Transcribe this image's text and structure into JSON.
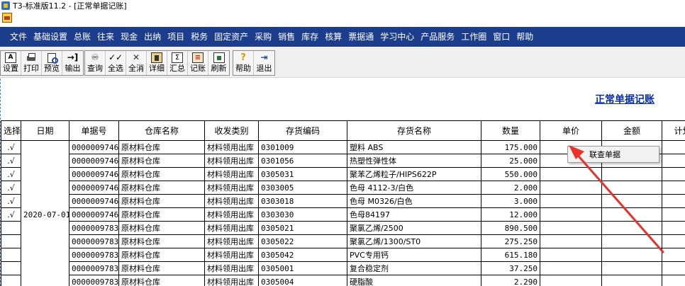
{
  "window": {
    "title": "T3-标准版11.2 - [正常单据记账]"
  },
  "menu": {
    "items": [
      "文件",
      "基础设置",
      "总账",
      "往来",
      "现金",
      "出纳",
      "项目",
      "税务",
      "固定资产",
      "采购",
      "销售",
      "库存",
      "核算",
      "票据通",
      "学习中心",
      "产品服务",
      "工作圈",
      "窗口",
      "帮助"
    ]
  },
  "toolbar": {
    "groups": [
      [
        {
          "label": "设置",
          "icon": "settings-icon"
        },
        {
          "label": "打印",
          "icon": "printer-icon"
        },
        {
          "label": "预览",
          "icon": "preview-icon"
        },
        {
          "label": "输出",
          "icon": "export-icon"
        }
      ],
      [
        {
          "label": "查询",
          "icon": "binoculars-icon"
        },
        {
          "label": "全选",
          "icon": "select-all-icon"
        },
        {
          "label": "全消",
          "icon": "deselect-all-icon"
        },
        {
          "label": "详细",
          "icon": "detail-icon"
        },
        {
          "label": "汇总",
          "icon": "summary-icon"
        },
        {
          "label": "记账",
          "icon": "ledger-icon"
        },
        {
          "label": "刷新",
          "icon": "refresh-icon"
        }
      ],
      [
        {
          "label": "帮助",
          "icon": "help-icon"
        },
        {
          "label": "退出",
          "icon": "exit-icon"
        }
      ]
    ]
  },
  "report": {
    "title": "正常单据记账"
  },
  "table": {
    "columns": [
      "选择",
      "日期",
      "单据号",
      "仓库名称",
      "收发类别",
      "存货编码",
      "存货名称",
      "数量",
      "单价",
      "金额",
      "计划"
    ],
    "date_group": "2020-07-01",
    "select_mark": ".√",
    "rows": [
      {
        "selected": true,
        "doc": "0000009746",
        "warehouse": "原材料仓库",
        "category": "材料领用出库",
        "code": "0301009",
        "name": "塑料 ABS",
        "qty": "175.000"
      },
      {
        "selected": true,
        "doc": "0000009746",
        "warehouse": "原材料仓库",
        "category": "材料领用出库",
        "code": "0301056",
        "name": "热塑性弹性体",
        "qty": "25.000"
      },
      {
        "selected": true,
        "doc": "0000009746",
        "warehouse": "原材料仓库",
        "category": "材料领用出库",
        "code": "0305031",
        "name": "聚苯乙烯粒子/HIPS622P",
        "qty": "550.000"
      },
      {
        "selected": true,
        "doc": "0000009746",
        "warehouse": "原材料仓库",
        "category": "材料领用出库",
        "code": "0303005",
        "name": "色母 4112-3/白色",
        "qty": "2.000"
      },
      {
        "selected": true,
        "doc": "0000009746",
        "warehouse": "原材料仓库",
        "category": "材料领用出库",
        "code": "0303018",
        "name": "色母 M0326/白色",
        "qty": "3.000"
      },
      {
        "selected": true,
        "doc": "0000009746",
        "warehouse": "原材料仓库",
        "category": "材料领用出库",
        "code": "0303030",
        "name": "色母84197",
        "qty": "12.000"
      },
      {
        "selected": false,
        "doc": "0000009783",
        "warehouse": "原材料仓库",
        "category": "材料领用出库",
        "code": "0305021",
        "name": "聚氯乙烯/2500",
        "qty": "890.500"
      },
      {
        "selected": false,
        "doc": "0000009783",
        "warehouse": "原材料仓库",
        "category": "材料领用出库",
        "code": "0305022",
        "name": "聚氯乙烯/1300/ST0",
        "qty": "275.250"
      },
      {
        "selected": false,
        "doc": "0000009783",
        "warehouse": "原材料仓库",
        "category": "材料领用出库",
        "code": "0305042",
        "name": "PVC专用钙",
        "qty": "615.180"
      },
      {
        "selected": false,
        "doc": "0000009783",
        "warehouse": "原材料仓库",
        "category": "材料领用出库",
        "code": "0305001",
        "name": "复合稳定剂",
        "qty": "37.250"
      },
      {
        "selected": false,
        "doc": "0000009783",
        "warehouse": "原材料仓库",
        "category": "材料领用出库",
        "code": "0305004",
        "name": "硬脂酸",
        "qty": "2.290"
      }
    ]
  },
  "context_menu": {
    "items": [
      "联查单据"
    ]
  },
  "colors": {
    "menubar": "#1c3d8c",
    "title_link": "#0a2ea8",
    "annotation_arrow": "#e8322a"
  }
}
